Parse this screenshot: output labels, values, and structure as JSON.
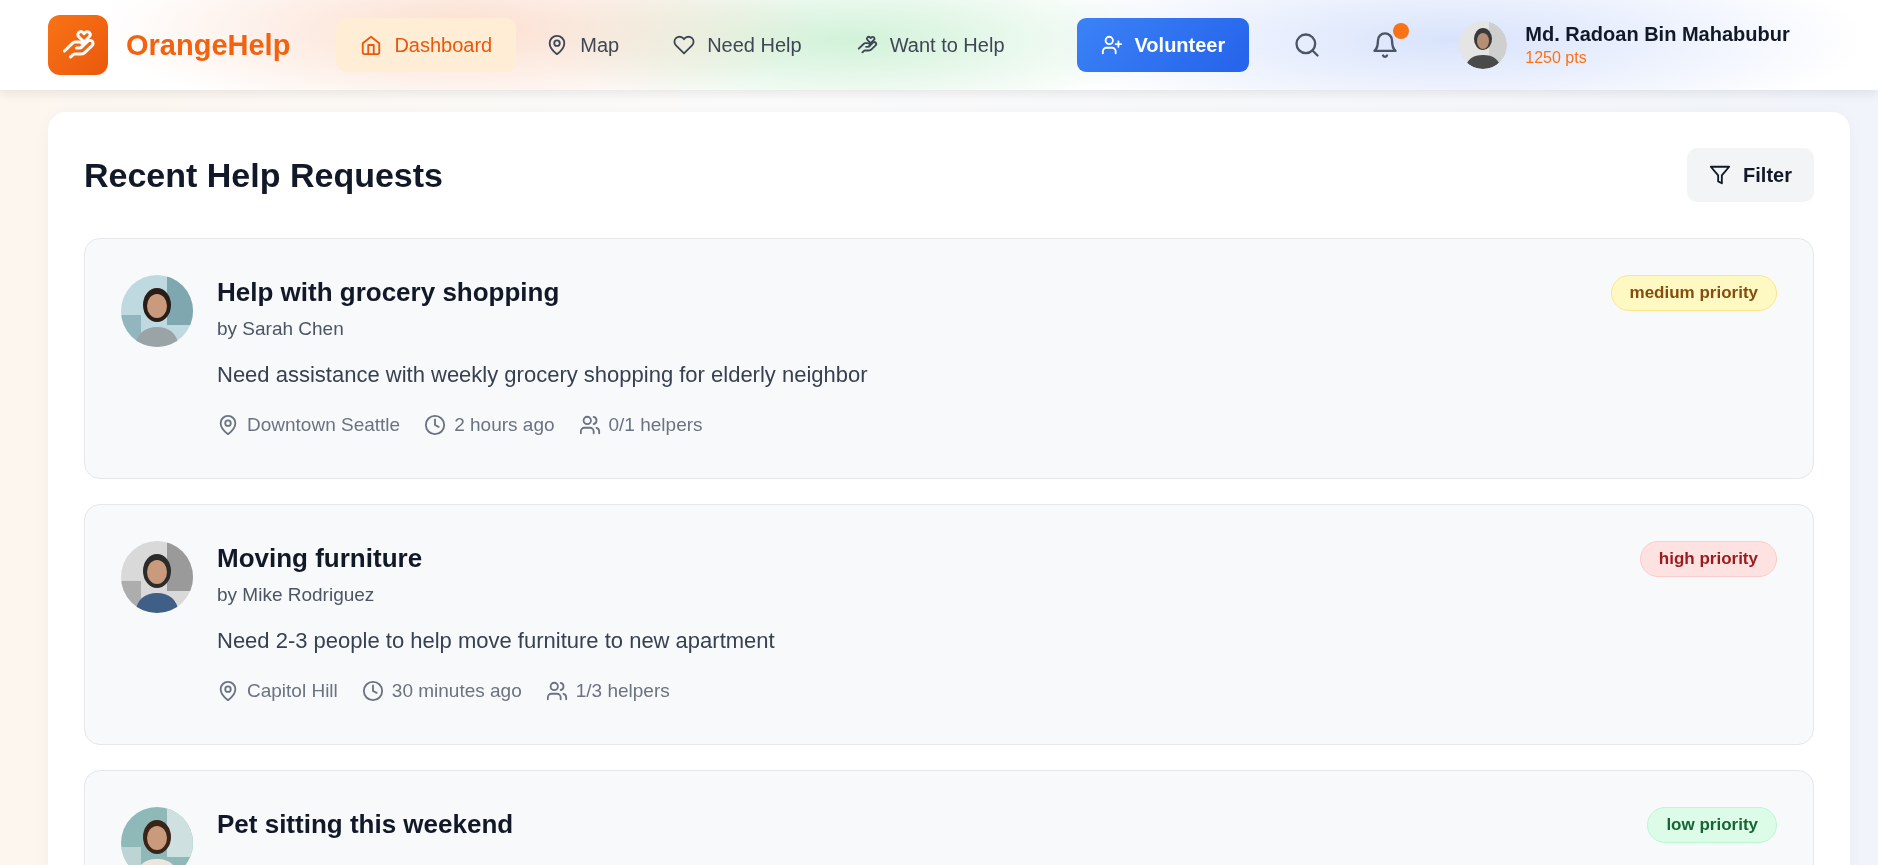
{
  "brand": {
    "name": "OrangeHelp"
  },
  "nav": [
    {
      "label": "Dashboard",
      "kind": "home",
      "selected": true
    },
    {
      "label": "Map",
      "kind": "pin",
      "selected": false
    },
    {
      "label": "Need Help",
      "kind": "heart",
      "selected": false
    },
    {
      "label": "Want to Help",
      "kind": "hand",
      "selected": false
    }
  ],
  "volunteer_button": "Volunteer",
  "notifications": {
    "unread": true
  },
  "user": {
    "name": "Md. Radoan Bin Mahabubur",
    "points": "1250 pts"
  },
  "section": {
    "title": "Recent Help Requests",
    "filter_button": "Filter"
  },
  "requests": [
    {
      "title": "Help with grocery shopping",
      "author": "by Sarah Chen",
      "description": "Need assistance with weekly grocery shopping for elderly neighbor",
      "location": "Downtown Seattle",
      "time": "2 hours ago",
      "helpers": "0/1 helpers",
      "kind": "medium",
      "badge": "medium priority"
    },
    {
      "title": "Moving furniture",
      "author": "by Mike Rodriguez",
      "description": "Need 2-3 people to help move furniture to new apartment",
      "location": "Capitol Hill",
      "time": "30 minutes ago",
      "helpers": "1/3 helpers",
      "kind": "high",
      "badge": "high priority"
    },
    {
      "title": "Pet sitting this weekend",
      "kind": "low",
      "badge": "low priority"
    }
  ]
}
